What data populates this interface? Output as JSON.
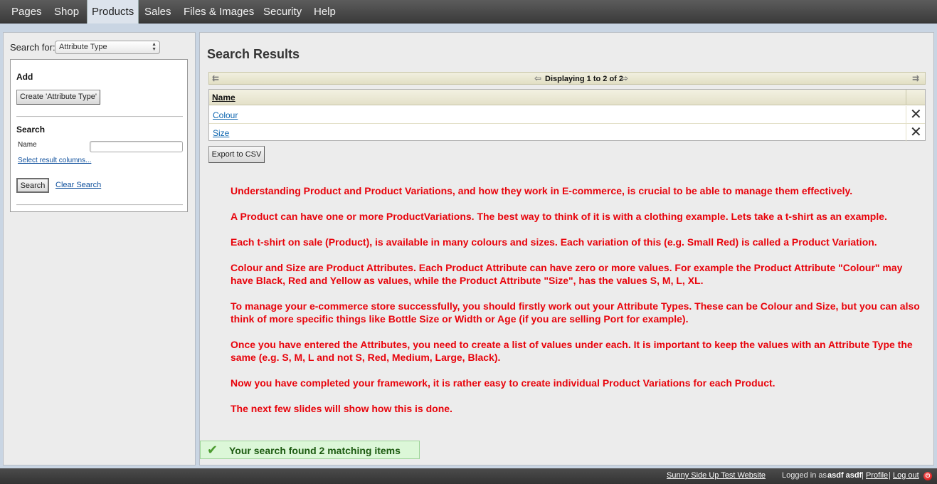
{
  "nav": {
    "tabs": [
      "Pages",
      "Shop",
      "Products",
      "Sales",
      "Files & Images",
      "Security",
      "Help"
    ],
    "active": "Products"
  },
  "sidebar": {
    "search_for_label": "Search for:",
    "search_for_value": "Attribute Type",
    "add_heading": "Add",
    "create_button": "Create 'Attribute Type'",
    "search_heading": "Search",
    "name_label": "Name",
    "name_value": "",
    "select_columns_link": "Select result columns...",
    "search_button": "Search",
    "clear_search_link": "Clear Search"
  },
  "main": {
    "title": "Search Results",
    "pager_text": "Displaying 1 to 2 of 2",
    "table": {
      "columns": [
        "Name"
      ],
      "rows": [
        {
          "name": "Colour"
        },
        {
          "name": "Size"
        }
      ]
    },
    "export_button": "Export to CSV",
    "info_paragraphs": [
      "Understanding Product and Product Variations, and how they work in E-commerce, is crucial to be able to manage them effectively.",
      "A Product can have one or more ProductVariations.  The best way to think of it is with a clothing example.  Lets take a t-shirt as an example.",
      "Each t-shirt on sale (Product), is available in many colours and sizes.  Each variation of this (e.g. Small Red) is called a Product Variation.",
      "Colour and Size are Product Attributes.  Each Product Attribute can have zero or more values. For example the Product Attribute \"Colour\" may have Black, Red and Yellow as values, while the Product Attribute \"Size\", has the values S, M, L, XL.",
      "To manage your e-commerce store successfully,  you should firstly work out your Attribute Types.  These can be Colour and Size, but you can also think of more specific things like Bottle Size or Width or Age (if you are selling Port for example).",
      "Once you have entered the Attributes, you need to create a list of values under each. It is important to keep the values with an Attribute Type the same (e.g. S, M, L and not S, Red, Medium, Large, Black).",
      "Now you have completed your framework, it is rather easy to create individual Product Variations for each Product.",
      "The next few slides will show how this is done."
    ],
    "status_message": "Your search found 2 matching items"
  },
  "footer": {
    "site_link": "Sunny Side Up Test Website",
    "site_sep": "-",
    "logged_in_prefix": "Logged in as",
    "user": "asdf asdf",
    "profile_link": "Profile",
    "logout_link": "Log out"
  },
  "colors": {
    "info_text": "#e8040c",
    "status_bg": "#dcf7d8",
    "link": "#0e66b0"
  },
  "icons": [
    "sort-arrows-icon",
    "first-page-icon",
    "prev-page-icon",
    "next-page-icon",
    "last-page-icon",
    "delete-icon",
    "check-icon",
    "power-icon"
  ]
}
